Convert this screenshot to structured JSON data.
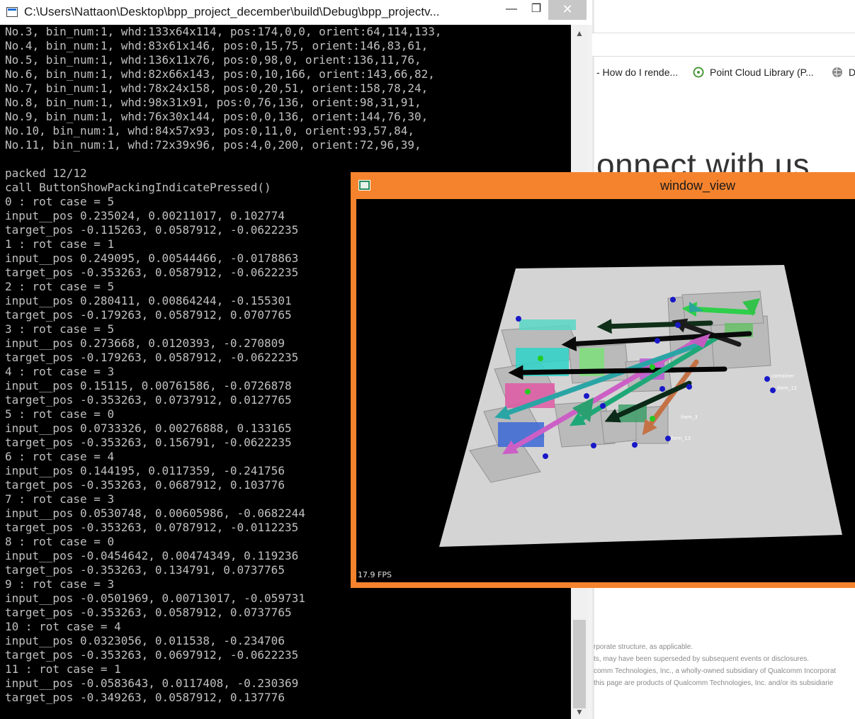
{
  "browser": {
    "bookmarks": [
      {
        "label": "- How do I rende...",
        "icon": "page-icon"
      },
      {
        "label": "Point Cloud Library (P...",
        "icon": "pcl-icon"
      },
      {
        "label": "D",
        "icon": "globe-icon"
      }
    ],
    "heading_fragment": "onnect with us",
    "legal_lines": [
      "rporate structure, as applicable.",
      "ts, may have been superseded by subsequent events or disclosures.",
      "comm Technologies, Inc., a wholly-owned subsidiary of Qualcomm Incorporat",
      "this page are products of Qualcomm Technologies, Inc. and/or its subsidiarie"
    ]
  },
  "console": {
    "title": "C:\\Users\\Nattaon\\Desktop\\bpp_project_december\\build\\Debug\\bpp_projectv...",
    "min_label": "—",
    "max_label": "❐",
    "close_label": "✕",
    "lines": [
      "No.3, bin_num:1, whd:133x64x114, pos:174,0,0, orient:64,114,133,",
      "No.4, bin_num:1, whd:83x61x146, pos:0,15,75, orient:146,83,61,",
      "No.5, bin_num:1, whd:136x11x76, pos:0,98,0, orient:136,11,76,",
      "No.6, bin_num:1, whd:82x66x143, pos:0,10,166, orient:143,66,82,",
      "No.7, bin_num:1, whd:78x24x158, pos:0,20,51, orient:158,78,24,",
      "No.8, bin_num:1, whd:98x31x91, pos:0,76,136, orient:98,31,91,",
      "No.9, bin_num:1, whd:76x30x144, pos:0,0,136, orient:144,76,30,",
      "No.10, bin_num:1, whd:84x57x93, pos:0,11,0, orient:93,57,84,",
      "No.11, bin_num:1, whd:72x39x96, pos:4,0,200, orient:72,96,39,",
      "",
      "packed 12/12",
      "call ButtonShowPackingIndicatePressed()",
      "0 : rot case = 5",
      "input__pos 0.235024, 0.00211017, 0.102774",
      "target_pos -0.115263, 0.0587912, -0.0622235",
      "1 : rot case = 1",
      "input__pos 0.249095, 0.00544466, -0.0178863",
      "target_pos -0.353263, 0.0587912, -0.0622235",
      "2 : rot case = 5",
      "input__pos 0.280411, 0.00864244, -0.155301",
      "target_pos -0.179263, 0.0587912, 0.0707765",
      "3 : rot case = 5",
      "input__pos 0.273668, 0.0120393, -0.270809",
      "target_pos -0.179263, 0.0587912, -0.0622235",
      "4 : rot case = 3",
      "input__pos 0.15115, 0.00761586, -0.0726878",
      "target_pos -0.353263, 0.0737912, 0.0127765",
      "5 : rot case = 0",
      "input__pos 0.0733326, 0.00276888, 0.133165",
      "target_pos -0.353263, 0.156791, -0.0622235",
      "6 : rot case = 4",
      "input__pos 0.144195, 0.0117359, -0.241756",
      "target_pos -0.353263, 0.0687912, 0.103776",
      "7 : rot case = 3",
      "input__pos 0.0530748, 0.00605986, -0.0682244",
      "target_pos -0.353263, 0.0787912, -0.0112235",
      "8 : rot case = 0",
      "input__pos -0.0454642, 0.00474349, 0.119236",
      "target_pos -0.353263, 0.134791, 0.0737765",
      "9 : rot case = 3",
      "input__pos -0.0501969, 0.00713017, -0.059731",
      "target_pos -0.353263, 0.0587912, 0.0737765",
      "10 : rot case = 4",
      "input__pos 0.0323056, 0.011538, -0.234706",
      "target_pos -0.353263, 0.0697912, -0.0622235",
      "11 : rot case = 1",
      "input__pos -0.0583643, 0.0117408, -0.230369",
      "target_pos -0.349263, 0.0587912, 0.137776"
    ]
  },
  "viewer": {
    "title": "window_view",
    "fps": "17.9 FPS",
    "scene_labels": [
      "container",
      "item_12",
      "item_13",
      "item_3"
    ]
  }
}
